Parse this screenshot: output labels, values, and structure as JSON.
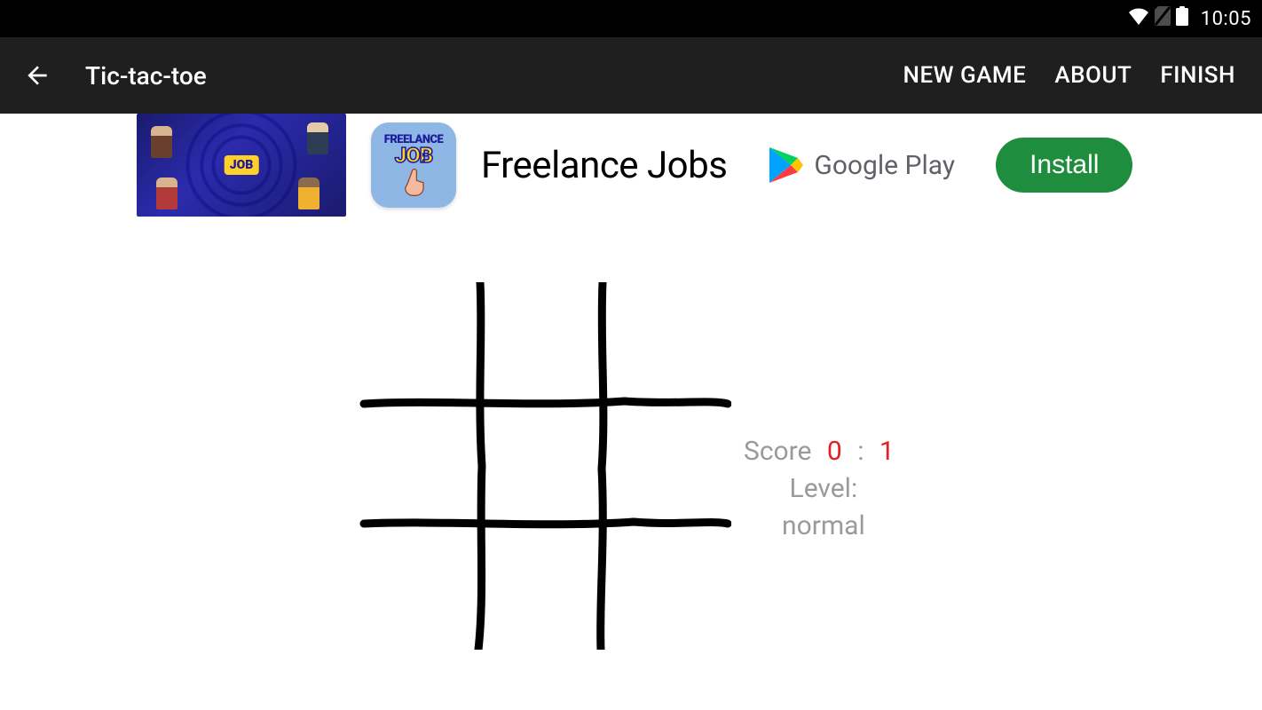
{
  "status": {
    "time": "10:05"
  },
  "appbar": {
    "title": "Tic-tac-toe",
    "menu": {
      "new_game": "NEW GAME",
      "about": "ABOUT",
      "finish": "FINISH"
    }
  },
  "ad": {
    "title": "Freelance Jobs",
    "store": "Google Play",
    "install": "Install",
    "icon_text_top": "FREELANCE",
    "icon_text_main": "JOB"
  },
  "game": {
    "score_label": "Score",
    "score_left": "0",
    "score_sep": ":",
    "score_right": "1",
    "level_label": "Level:",
    "level_value": "normal",
    "board": [
      [
        "",
        "",
        ""
      ],
      [
        "",
        "",
        ""
      ],
      [
        "",
        "",
        ""
      ]
    ]
  }
}
